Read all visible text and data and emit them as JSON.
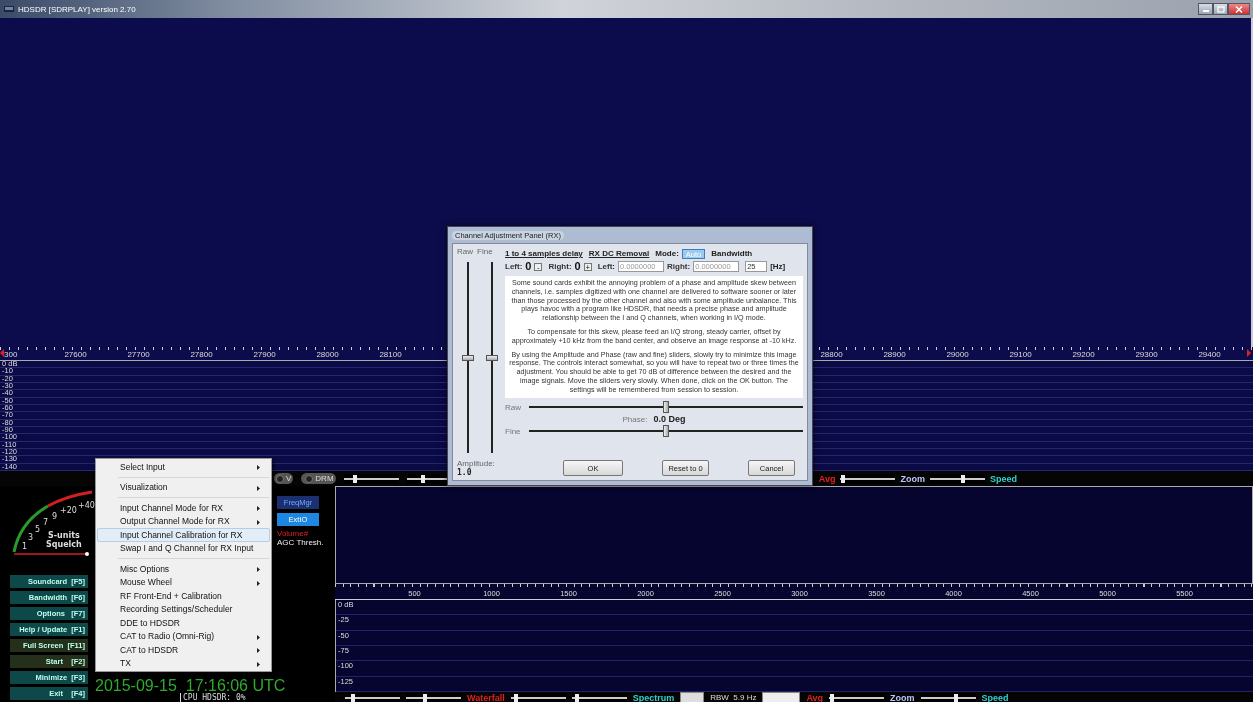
{
  "window": {
    "title": "HDSDR [SDRPLAY]  version 2.70",
    "controls": [
      {
        "kind": "minimize"
      },
      {
        "kind": "maximize"
      },
      {
        "kind": "close"
      }
    ]
  },
  "freq_axis": {
    "left_labels": [
      "300",
      "27600",
      "27700",
      "27800",
      "27900",
      "28000",
      "28100"
    ],
    "right_labels": [
      "28800",
      "28900",
      "29000",
      "29100",
      "29200",
      "29300",
      "29400"
    ]
  },
  "level_scale": {
    "labels": [
      "0 dB",
      "-10",
      "-20",
      "-30",
      "-40",
      "-50",
      "-60",
      "-70",
      "-80",
      "-90",
      "-100",
      "-110",
      "-120",
      "-130",
      "-140"
    ]
  },
  "control_bar": {
    "left": [
      {
        "kind": "toggle",
        "label": "V",
        "on": false
      },
      {
        "kind": "toggle",
        "label": "DRM",
        "on": false
      },
      {
        "kind": "slider",
        "level": 0.2
      },
      {
        "kind": "slider",
        "level": 0.3
      }
    ],
    "right": [
      {
        "kind": "label",
        "text": "Avg",
        "color": "#e02020"
      },
      {
        "kind": "slider",
        "level": 0.05
      },
      {
        "kind": "label",
        "text": "Zoom",
        "color": "#b8c8ff"
      },
      {
        "kind": "slider",
        "level": 0.6
      },
      {
        "kind": "label",
        "text": "Speed",
        "color": "#30d0d0"
      }
    ]
  },
  "meter": {
    "scale": [
      "1",
      "3",
      "5",
      "7",
      "9",
      "+20",
      "+40"
    ],
    "title": "S-units",
    "subtitle": "Squelch"
  },
  "function_buttons": [
    {
      "label": "Soundcard  [F5]",
      "color": "#0e4848"
    },
    {
      "label": "Bandwidth  [F6]",
      "color": "#0e4848"
    },
    {
      "label": "Options   [F7]",
      "color": "#0e4848"
    },
    {
      "label": "Help / Update  [F1]",
      "color": "#0e4848"
    },
    {
      "label": "Full Screen  [F11]",
      "color": "#25301a"
    },
    {
      "label": "Start    [F2]",
      "color": "#25301a"
    },
    {
      "label": "Minimize  [F3]",
      "color": "#0e4848"
    },
    {
      "label": "Exit    [F4]",
      "color": "#0e4848"
    }
  ],
  "side_buttons": [
    {
      "label": "FreqMgr",
      "kind": "dark"
    },
    {
      "label": "ExtIO",
      "kind": "bright"
    }
  ],
  "volume_label": "Volume#",
  "agc_label": "AGC Thresh.",
  "clock": {
    "datetime": "2015-09-15  17:16:06 UTC",
    "cpu": "CPU HDSDR: 0%"
  },
  "audio_axis": {
    "labels": [
      "500",
      "1000",
      "1500",
      "2000",
      "2500",
      "3000",
      "3500",
      "4000",
      "4500",
      "5000",
      "5500"
    ]
  },
  "audio_scale": {
    "labels": [
      "0 dB",
      "-25",
      "-50",
      "-75",
      "-100",
      "-125"
    ]
  },
  "audio_bar": {
    "items": [
      {
        "kind": "slider",
        "level": 0.15
      },
      {
        "kind": "slider",
        "level": 0.35
      },
      {
        "kind": "label",
        "text": "Waterfall",
        "color": "#e02020"
      },
      {
        "kind": "slider",
        "level": 0.1
      },
      {
        "kind": "slider",
        "level": 0.1
      },
      {
        "kind": "label",
        "text": "Spectrum",
        "color": "#30d0d0"
      },
      {
        "kind": "stepper"
      },
      {
        "kind": "reading",
        "text": "RBW  5.9 Hz"
      },
      {
        "kind": "dropdown"
      },
      {
        "kind": "label",
        "text": "Avg",
        "color": "#e02020"
      },
      {
        "kind": "slider",
        "level": 0.05
      },
      {
        "kind": "label",
        "text": "Zoom",
        "color": "#b8c8ff"
      },
      {
        "kind": "slider",
        "level": 0.65
      },
      {
        "kind": "label",
        "text": "Speed",
        "color": "#30d0d0"
      }
    ]
  },
  "context_menu": {
    "items": [
      {
        "kind": "item",
        "label": "Select Input",
        "submenu": true,
        "selected": false
      },
      {
        "kind": "separator"
      },
      {
        "kind": "item",
        "label": "Visualization",
        "submenu": true,
        "selected": false
      },
      {
        "kind": "separator"
      },
      {
        "kind": "item",
        "label": "Input Channel Mode for RX",
        "submenu": true,
        "selected": false
      },
      {
        "kind": "item",
        "label": "Output Channel Mode for RX",
        "submenu": true,
        "selected": false
      },
      {
        "kind": "item",
        "label": "Input Channel Calibration for RX",
        "submenu": false,
        "selected": true
      },
      {
        "kind": "item",
        "label": "Swap I and Q Channel for RX Input",
        "submenu": false,
        "selected": false
      },
      {
        "kind": "separator"
      },
      {
        "kind": "item",
        "label": "Misc Options",
        "submenu": true,
        "selected": false
      },
      {
        "kind": "item",
        "label": "Mouse Wheel",
        "submenu": true,
        "selected": false
      },
      {
        "kind": "item",
        "label": "RF Front-End + Calibration",
        "submenu": false,
        "selected": false
      },
      {
        "kind": "item",
        "label": "Recording Settings/Scheduler",
        "submenu": false,
        "selected": false
      },
      {
        "kind": "item",
        "label": "DDE to HDSDR",
        "submenu": false,
        "selected": false
      },
      {
        "kind": "item",
        "label": "CAT to Radio (Omni-Rig)",
        "submenu": true,
        "selected": false
      },
      {
        "kind": "item",
        "label": "CAT to HDSDR",
        "submenu": true,
        "selected": false
      },
      {
        "kind": "item",
        "label": "TX",
        "submenu": true,
        "selected": false
      }
    ]
  },
  "dialog": {
    "title": "Channel Adjustment Panel (RX)",
    "amplitude": {
      "sliders": [
        {
          "label": "Raw",
          "level": 0.5
        },
        {
          "label": "Fine",
          "level": 0.5
        }
      ],
      "label": "Amplitude:",
      "value": "1.0"
    },
    "delay": {
      "heading": "1 to 4 samples delay",
      "left_label": "Left:",
      "left_value": "0",
      "left_button": "-",
      "right_label": "Right:",
      "right_value": "0",
      "right_button": "+"
    },
    "dc_removal": {
      "heading": "RX DC Removal",
      "left_label": "Left:",
      "left_value": "0.0000000",
      "right_label": "Right:",
      "right_value": "0.0000000"
    },
    "mode": {
      "label": "Mode:",
      "button": "Auto"
    },
    "bandwidth": {
      "heading": "Bandwidth",
      "value": "25",
      "unit": "[Hz]"
    },
    "paragraphs": [
      "Some sound cards exhibit the annoying problem of a phase and amplitude skew between channels, i.e. samples digitized with one channel are delivered to software sooner or later than those processed by the other channel and also with some amplitude unbalance. This plays havoc with a program like HDSDR, that needs a precise phase and amplitude relationship between the I and Q channels, when working in I/Q mode.",
      "To compensate for this skew, please feed an I/Q strong, steady carrier, offset by approximately +10 kHz from the band center, and observe an image response at -10 kHz.",
      "By using the Amplitude and Phase (raw and fine) sliders, slowly try to minimize this image response. The controls interact somewhat, so you will have to repeat two or three times the adjustment. You should be able to get 70 dB of difference between the desired and the image signals. Move the sliders very slowly. When done, click on the OK button. The settings will be remembered from session to session."
    ],
    "phase": {
      "sliders": [
        {
          "label": "Raw",
          "level": 0.5
        },
        {
          "label": "Fine",
          "level": 0.5
        }
      ],
      "label": "Phase:",
      "value": "0.0 Deg"
    },
    "buttons": [
      "OK",
      "Reset to 0",
      "Cancel"
    ]
  }
}
